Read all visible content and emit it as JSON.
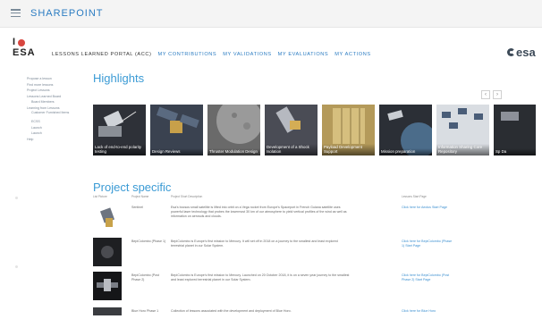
{
  "suite_bar": {
    "title": "SHAREPOINT",
    "menu_icon": "waffle-menu-icon"
  },
  "logo": {
    "line1": "I",
    "line2": "ESA",
    "heart_color": "#d8463f"
  },
  "top_nav": {
    "items": [
      {
        "label": "LESSONS LEARNED PORTAL (ACC)"
      },
      {
        "label": "MY CONTRIBUTIONS"
      },
      {
        "label": "MY VALIDATIONS"
      },
      {
        "label": "MY EVALUATIONS"
      },
      {
        "label": "MY ACTIONS"
      }
    ]
  },
  "brand_logo": {
    "text": "esa"
  },
  "sidebar": {
    "items": [
      {
        "label": "Propose a lesson"
      },
      {
        "label": "Find more lessons"
      },
      {
        "label": "Project Lessons"
      },
      {
        "label": "Lessons Learned Board"
      },
      {
        "label": "Board Members"
      },
      {
        "label": "Learning from Lessons"
      },
      {
        "label": "Customer Furnished Items"
      },
      {
        "label": "ECSS"
      },
      {
        "label": "Launch"
      },
      {
        "label": "Launch"
      },
      {
        "label": "Help"
      }
    ]
  },
  "highlights": {
    "title": "Highlights",
    "prev_label": "‹",
    "next_label": "›",
    "tiles": [
      {
        "caption": "Lack of end-to-end polarity testing",
        "bg": "#2e3138"
      },
      {
        "caption": "Design Reviews",
        "bg": "#3a4250"
      },
      {
        "caption": "Thruster Modulation Design",
        "bg": "#6a6a6a"
      },
      {
        "caption": "Development of a Shock Isolation",
        "bg": "#4a4c55"
      },
      {
        "caption": "Payload Development Support",
        "bg": "#b49a5a"
      },
      {
        "caption": "Mission preparation",
        "bg": "#2b2f36"
      },
      {
        "caption": "Information Sharing Core Repository",
        "bg": "#d9dde2"
      },
      {
        "caption": "Sp Da",
        "bg": "#2a2d32"
      }
    ]
  },
  "project_specific": {
    "title": "Project specific",
    "columns": [
      "List Picture",
      "Project Name",
      "Project Short Description",
      "Lessons Start Page"
    ],
    "rows": [
      {
        "name": "Sentinel",
        "description": "Esa's bocsos small satellite is lifted into orbit on a Vega rocket from Europe's Spaceport in French Guiana satellite uses powerful laser technology that probes the lowermost 30 km of our atmosphere to yield vertical profiles of the wind as well as information on aerosols and clouds.",
        "link": "Click here for Aeolus Start Page"
      },
      {
        "name": "BepiColombo (Phase 1)",
        "description": "BepiColombo is Europe's first mission to Mercury. It will set off in 2018 on a journey to the smallest and least explored terrestrial planet in our Solar System.",
        "link": "Click here for BepiColombo (Phase 1) Start Page"
      },
      {
        "name": "BepiColombo (Post Phase 2)",
        "description": "BepiColombo is Europe's first mission to Mercury. Launched on 20 October 2018, it is on a seven year journey to the smallest and least explored terrestrial planet in our Solar System.",
        "link": "Click here for BepiColombo (Post Phase 2) Start Page"
      },
      {
        "name": "Blue Horo Phase 1",
        "description": "Collection of lessons associated with the development and deployment of Blue Horo.",
        "link": "Click here for Blue Horo"
      }
    ]
  }
}
